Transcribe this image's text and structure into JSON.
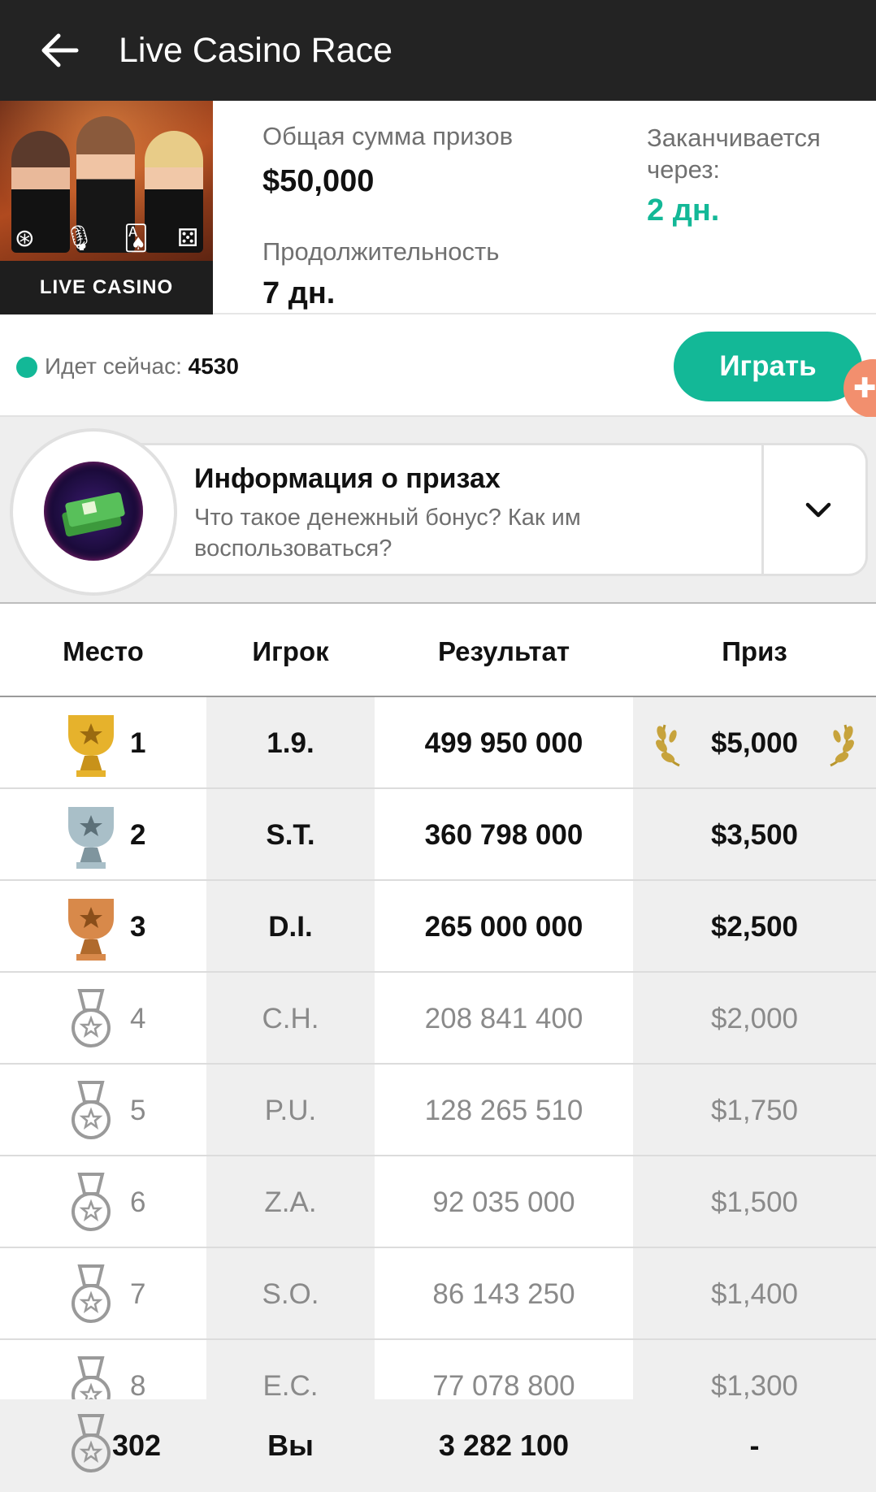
{
  "header": {
    "title": "Live Casino Race"
  },
  "banner": {
    "label": "LIVE CASINO",
    "icons": [
      "roulette-icon",
      "microphone-icon",
      "cards-icon",
      "dice-icon"
    ]
  },
  "stats": {
    "total_label": "Общая сумма призов",
    "total_value": "$50,000",
    "duration_label": "Продолжительность",
    "duration_value": "7 дн.",
    "ends_label": "Заканчивается через:",
    "ends_value": "2 дн."
  },
  "live": {
    "label": "Идет сейчас:",
    "count": "4530",
    "play_label": "Играть"
  },
  "prize_info": {
    "title": "Информация о призах",
    "description": "Что такое денежный бонус? Как им воспользоваться?"
  },
  "table": {
    "headers": [
      "Место",
      "Игрок",
      "Результат",
      "Приз"
    ],
    "rows": [
      {
        "place": "1",
        "player": "1.9.",
        "result": "499 950 000",
        "prize": "$5,000",
        "medal": "gold-trophy"
      },
      {
        "place": "2",
        "player": "S.T.",
        "result": "360 798 000",
        "prize": "$3,500",
        "medal": "silver-trophy"
      },
      {
        "place": "3",
        "player": "D.I.",
        "result": "265 000 000",
        "prize": "$2,500",
        "medal": "bronze-trophy"
      },
      {
        "place": "4",
        "player": "C.H.",
        "result": "208 841 400",
        "prize": "$2,000",
        "medal": "medal"
      },
      {
        "place": "5",
        "player": "P.U.",
        "result": "128 265 510",
        "prize": "$1,750",
        "medal": "medal"
      },
      {
        "place": "6",
        "player": "Z.A.",
        "result": "92 035 000",
        "prize": "$1,500",
        "medal": "medal"
      },
      {
        "place": "7",
        "player": "S.O.",
        "result": "86 143 250",
        "prize": "$1,400",
        "medal": "medal"
      },
      {
        "place": "8",
        "player": "E.C.",
        "result": "77 078 800",
        "prize": "$1,300",
        "medal": "medal"
      }
    ],
    "you": {
      "place": "302",
      "player": "Вы",
      "result": "3 282 100",
      "prize": "-"
    }
  },
  "colors": {
    "accent": "#13b897",
    "topbar": "#232323",
    "gold": "#d9a520",
    "silver": "#8fa4ad",
    "bronze": "#c7773a"
  }
}
